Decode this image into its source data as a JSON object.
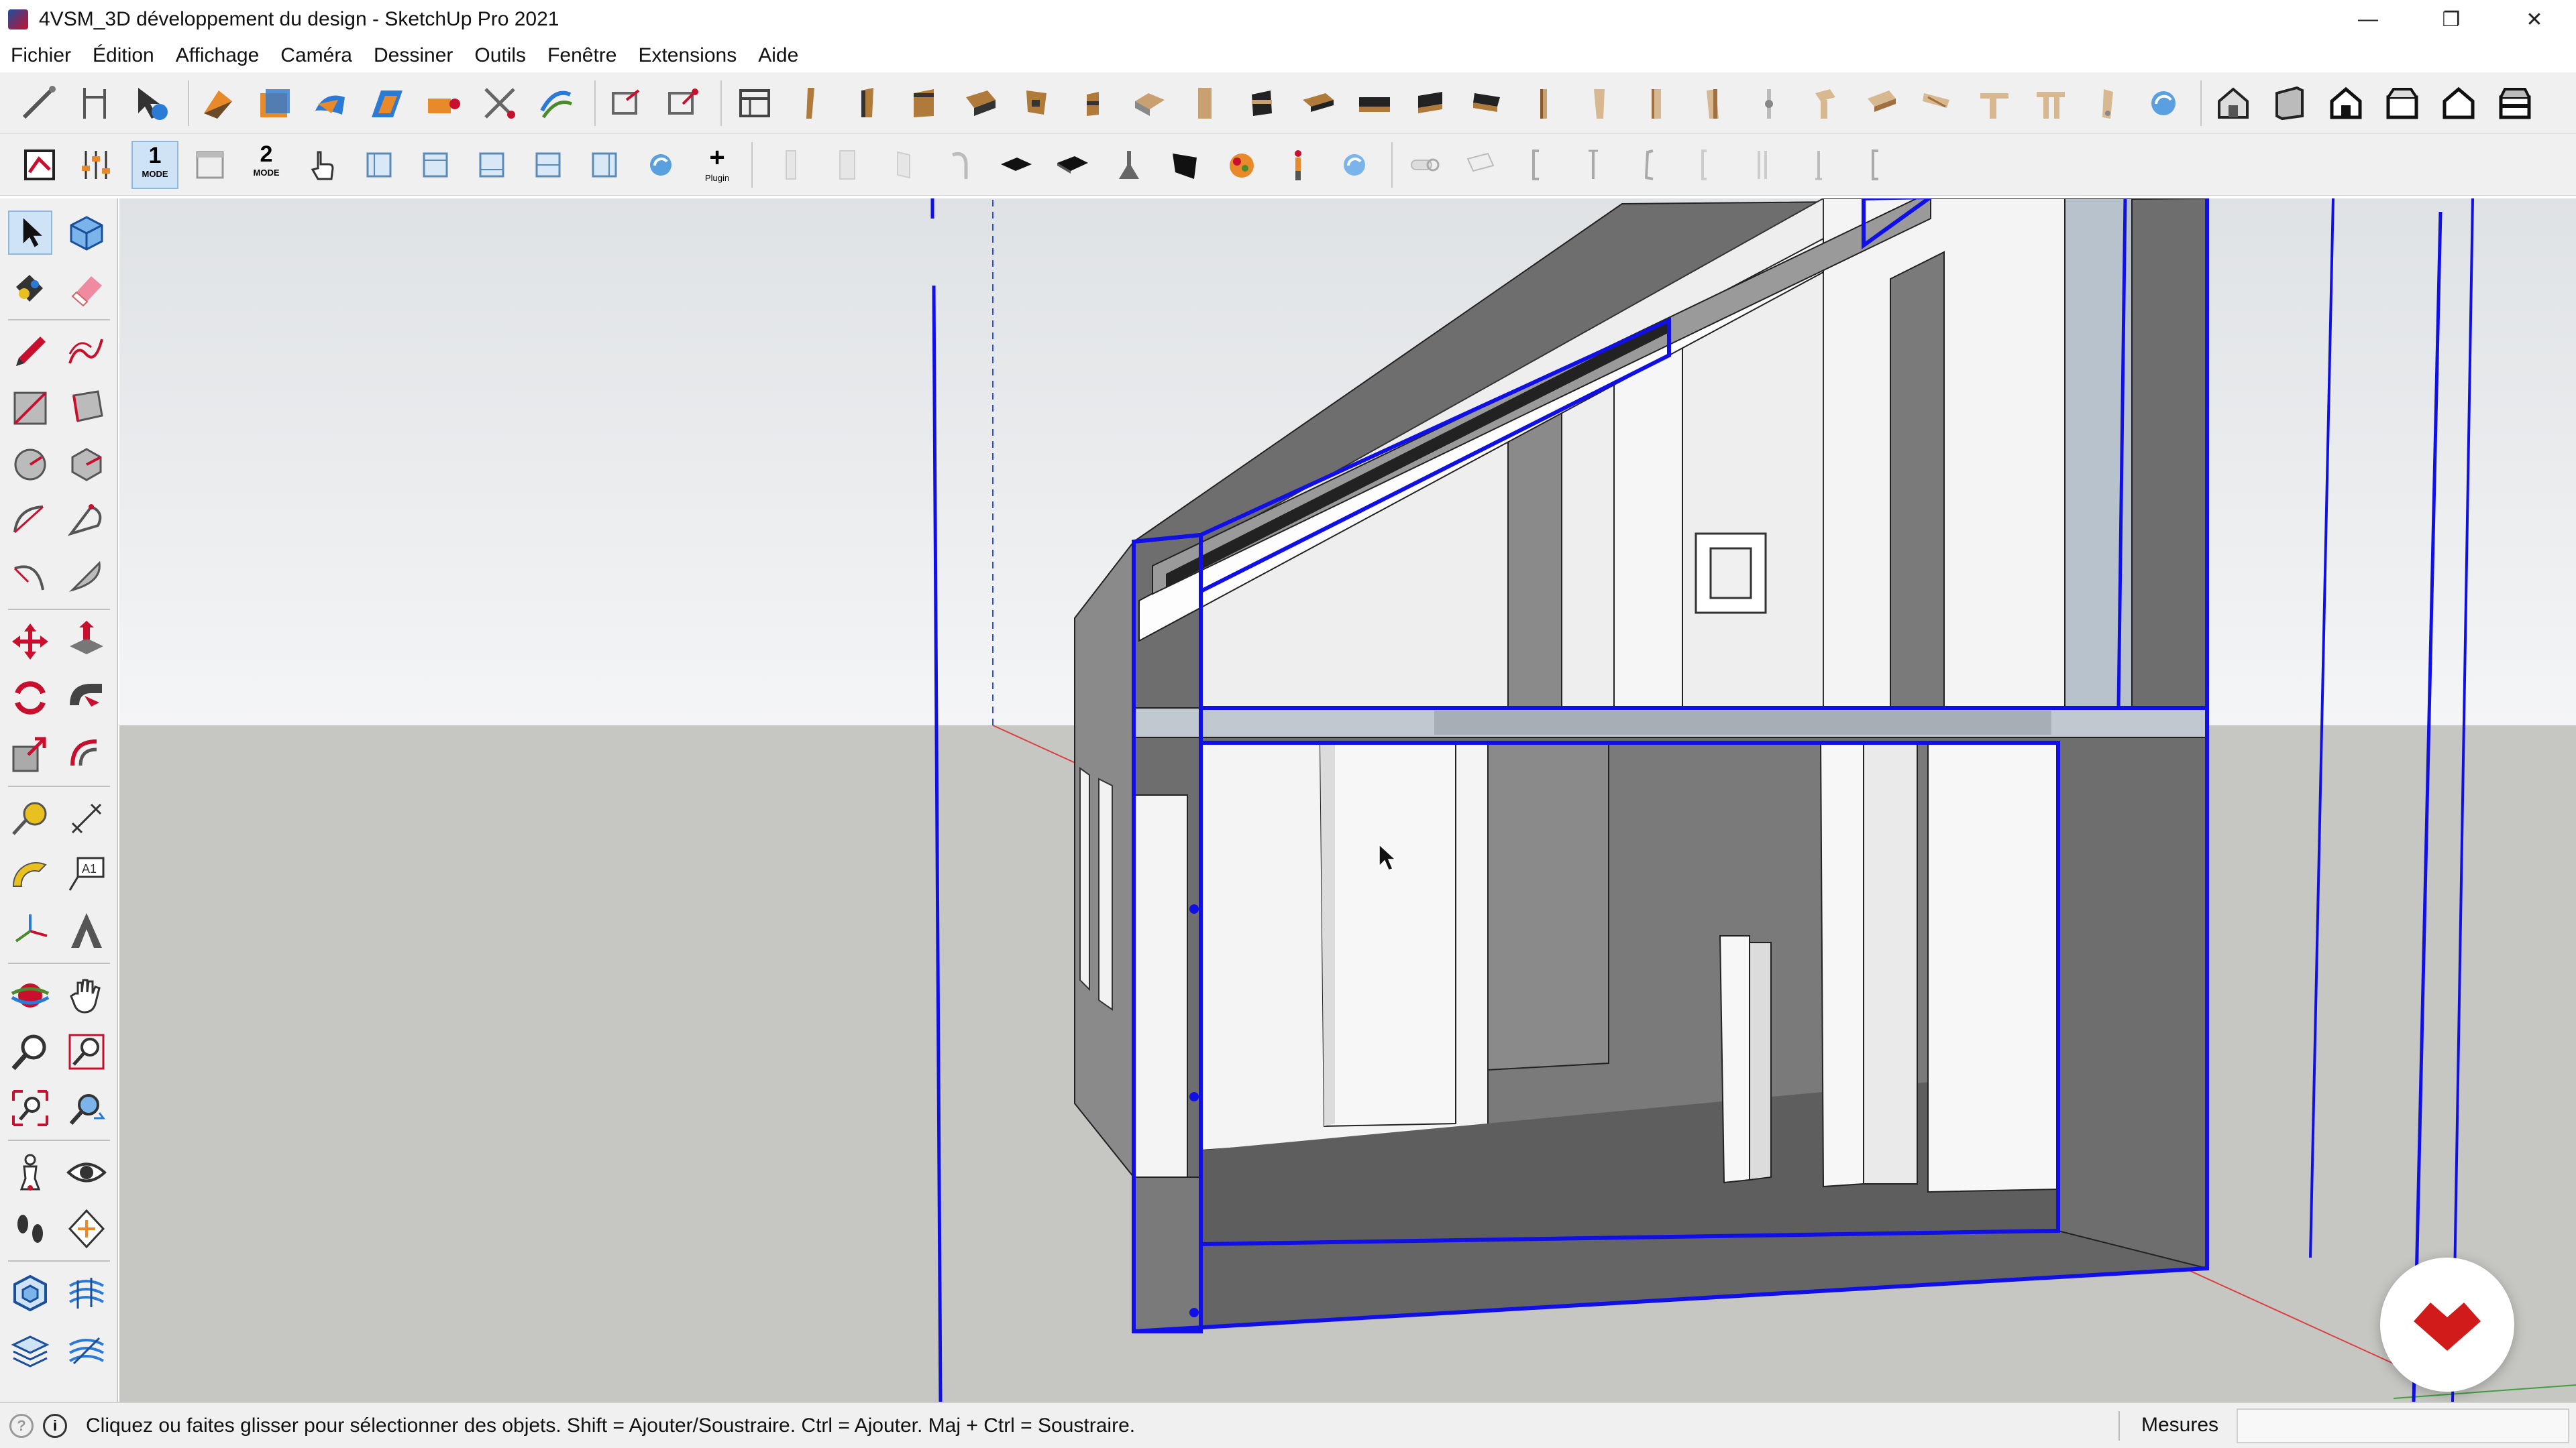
{
  "window": {
    "title": "4VSM_3D développement du design - SketchUp Pro 2021",
    "minimize": "—",
    "maximize": "❐",
    "close": "✕"
  },
  "menu": {
    "items": [
      "Fichier",
      "Édition",
      "Affichage",
      "Caméra",
      "Dessiner",
      "Outils",
      "Fenêtre",
      "Extensions",
      "Aide"
    ]
  },
  "toolbar2": {
    "mode1_num": "1",
    "mode1_label": "MODE",
    "mode2_num": "2",
    "mode2_label": "MODE",
    "plugin_symbol": "+",
    "plugin_label": "Plugin"
  },
  "status": {
    "message": "Cliquez ou faites glisser pour sélectionner des objets. Shift = Ajouter/Soustraire. Ctrl = Ajouter. Maj + Ctrl = Soustraire.",
    "info_symbol": "i",
    "measure_label": "Mesures",
    "measure_value": ""
  },
  "colors": {
    "selection_blue": "#1010e6",
    "sky_top": "#e2e5e8",
    "ground": "#c6c6c2",
    "wall_gray": "#6e6e6e",
    "floor_dark": "#656565",
    "badge_red": "#d11a1a"
  }
}
